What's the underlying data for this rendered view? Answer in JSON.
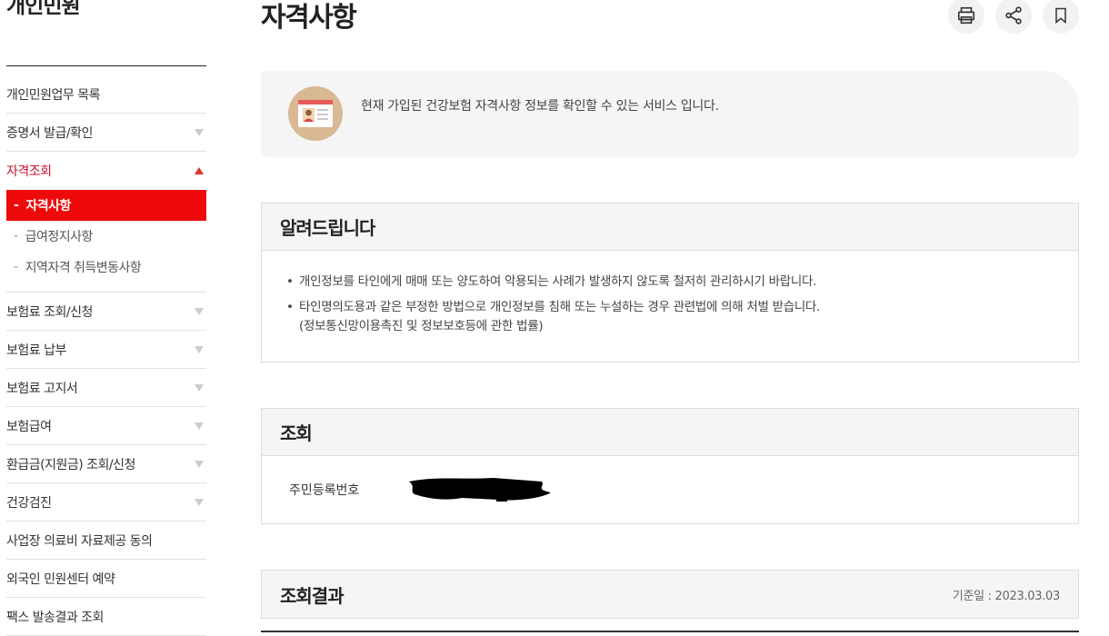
{
  "sidebar": {
    "title": "개인민원",
    "items": [
      {
        "label": "개인민원업무 목록"
      },
      {
        "label": "증명서 발급/확인"
      },
      {
        "label": "자격조회"
      },
      {
        "label": "보험료 조회/신청"
      },
      {
        "label": "보험료 납부"
      },
      {
        "label": "보험료 고지서"
      },
      {
        "label": "보험급여"
      },
      {
        "label": "환급금(지원금) 조회/신청"
      },
      {
        "label": "건강검진"
      },
      {
        "label": "사업장 의료비 자료제공 동의"
      },
      {
        "label": "외국인 민원센터 예약"
      },
      {
        "label": "팩스 발송결과 조회"
      }
    ],
    "sub_items": [
      {
        "label": "자격사항"
      },
      {
        "label": "급여정지사항"
      },
      {
        "label": "지역자격 취득변동사항"
      }
    ]
  },
  "main": {
    "title": "자격사항",
    "toolbar": {
      "print_icon": "print-icon",
      "share_icon": "share-icon",
      "bookmark_icon": "bookmark-icon"
    },
    "intro_text": "현재 가입된 건강보험 자격사항 정보를 확인할 수 있는 서비스 입니다.",
    "notice": {
      "title": "알려드립니다",
      "items": [
        "개인정보를 타인에게 매매 또는 양도하여 악용되는 사례가 발생하지 않도록 철저히 관리하시기 바랍니다.",
        "타인명의도용과 같은 부정한 방법으로 개인정보를 침해 또는 누설하는 경우 관련법에 의해 처벌 받습니다."
      ],
      "item2_sub": "(정보통신망이용촉진 및 정보보호등에 관한 법률)"
    },
    "query": {
      "title": "조회",
      "rrn_label": "주민등록번호"
    },
    "result": {
      "title": "조회결과",
      "base_date": "기준일 : 2023.03.03"
    }
  },
  "colors": {
    "accent": "#ee0a0a",
    "active_text": "#c8102e",
    "panel_bg": "#f5f5f5"
  }
}
